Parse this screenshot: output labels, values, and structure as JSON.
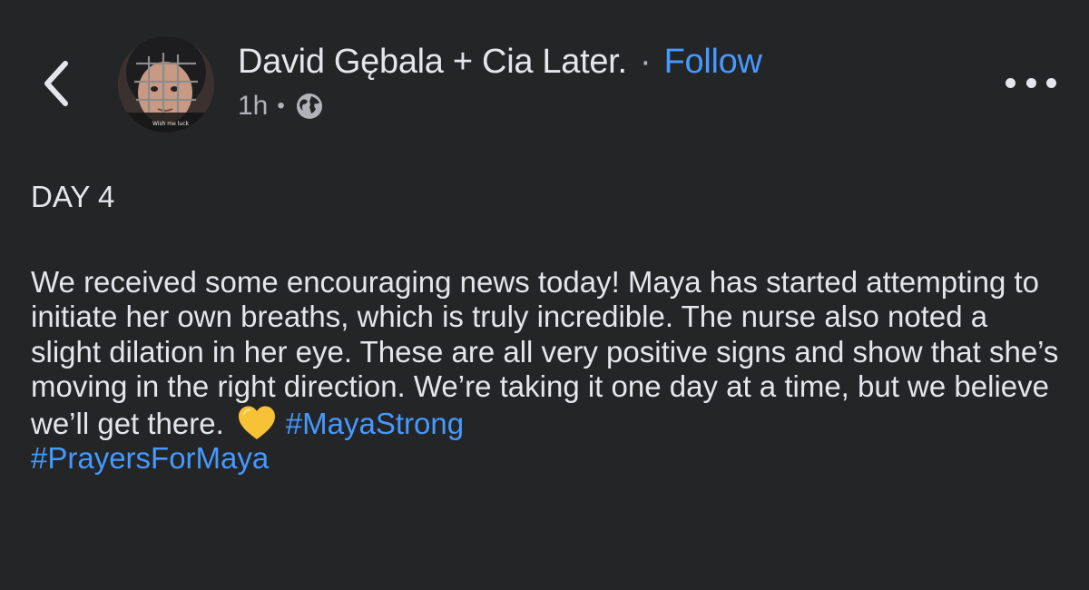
{
  "header": {
    "author_name": "David Gębala + Cia Later.",
    "separator": "·",
    "follow_label": "Follow",
    "timestamp": "1h",
    "meta_separator": "•",
    "audience_icon": "globe-icon",
    "avatar_caption": "Wish me luck",
    "back_icon": "chevron-left-icon",
    "more_icon": "more-horizontal-icon"
  },
  "post": {
    "title": "DAY 4",
    "text": "We received some encouraging news today! Maya has started attempting to initiate her own breaths, which is truly incredible. The nurse also noted a slight dilation in her eye. These are all very positive signs and show that she’s moving in the right direction. We’re taking it one day at a time, but we believe we’ll get there.",
    "emoji_icon": "yellow-heart-icon",
    "hashtags": [
      "#MayaStrong",
      "#PrayersForMaya"
    ]
  },
  "colors": {
    "background": "#242526",
    "text": "#e4e6eb",
    "secondary_text": "#b0b3b8",
    "link": "#4599ff",
    "heart": "#f7c235"
  }
}
